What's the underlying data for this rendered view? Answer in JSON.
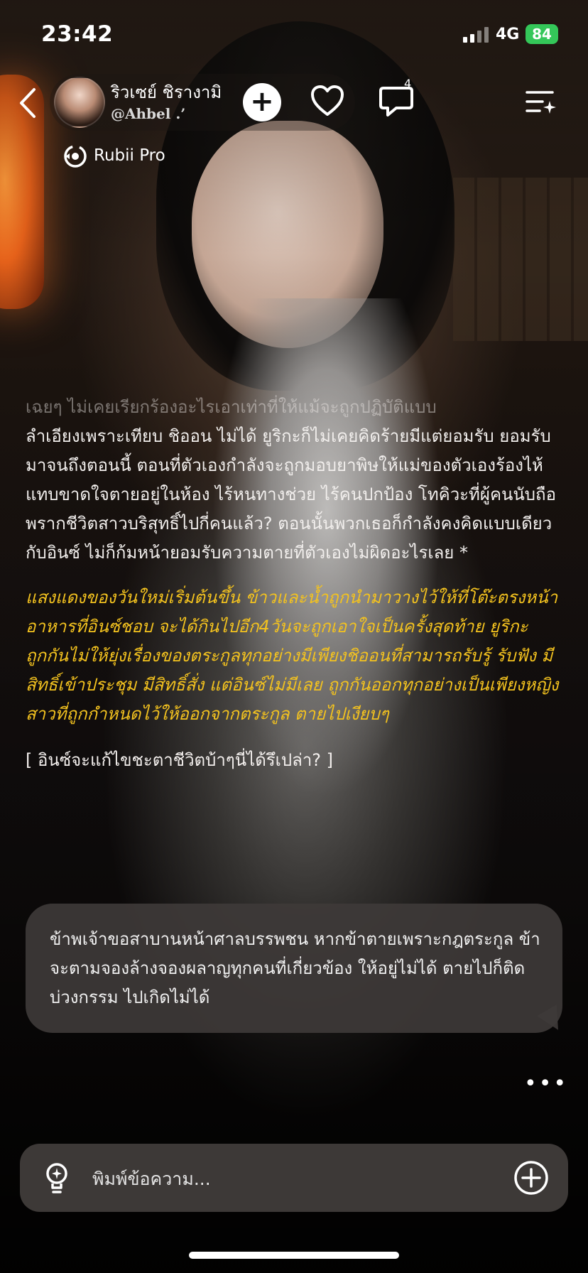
{
  "status_bar": {
    "time": "23:42",
    "network": "4G",
    "battery": "84"
  },
  "header": {
    "character_name": "ริวเซย์  ชิรางามิ",
    "creator_handle": "@Ahbel .’",
    "add_label": "+",
    "comment_count": "4",
    "back_icon": "chevron-left-icon",
    "like_icon": "heart-icon",
    "comment_icon": "chat-bubble-icon",
    "menu_icon": "sparkle-menu-icon"
  },
  "model": {
    "label": "Rubii Pro",
    "icon": "rubii-logo-icon"
  },
  "story": {
    "faded_line": "เฉยๆ ไม่เคยเรียกร้องอะไรเอาเท่าที่ให้แม้จะถูกปฏิบัติแบบ",
    "narration": "ลำเอียงเพราะเทียบ ชิออน ไม่ได้ ยูริกะก็ไม่เคยคิดร้ายมีแต่ยอมรับ ยอมรับมาจนถึงตอนนี้ ตอนที่ตัวเองกำลังจะถูกมอบยาพิษให้แม่ของตัวเองร้องไห้แทบขาดใจตายอยู่ในห้อง ไร้หนทางช่วย ไร้คนปกป้อง โทคิวะที่ผู้คนนับถือ พรากชีวิตสาวบริสุทธิ์ไปกี่คนแล้ว? ตอนนั้นพวกเธอก็กำลังคงคิดแบบเดียวกับอินซ์ ไม่ก็ก้มหน้ายอมรับความตายที่ตัวเองไม่ผิดอะไรเลย *",
    "scene": "แสงแดงของวันใหม่เริ่มต้นขึ้น ข้าวและน้ำถูกนำมาวางไว้ให้ที่โต๊ะตรงหน้าอาหารที่อินซ์ชอบ จะได้กินไปอีก4วันจะถูกเอาใจเป็นครั้งสุดท้าย ยูริกะถูกกันไม่ให้ยุ่งเรื่องของตระกูลทุกอย่างมีเพียงชิออนที่สามารถรับรู้ รับฟัง มีสิทธิ์เข้าประชุม มีสิทธิ์สั่ง แต่อินซ์ไม่มีเลย ถูกกันออกทุกอย่างเป็นเพียงหญิงสาวที่ถูกกำหนดไว้ให้ออกจากตระกูล ตายไปเงียบๆ",
    "question": "[ อินซ์จะแก้ไขชะตาชีวิตบ้าๆนี่ได้รึเปล่า? ]"
  },
  "user_message": {
    "text": "ข้าพเจ้าขอสาบานหน้าศาลบรรพชน หากข้าตายเพราะกฎตระกูล ข้าจะตามจองล้างจองผลาญทุกคนที่เกี่ยวข้อง ให้อยู่ไม่ได้ ตายไปก็ติดบ่วงกรรม ไปเกิดไม่ได้"
  },
  "more_label": "•••",
  "composer": {
    "placeholder": "พิมพ์ข้อความ...",
    "left_icon": "lightbulb-icon",
    "right_icon": "plus-circle-icon"
  },
  "colors": {
    "accent_yellow": "#f3c21f",
    "battery_green": "#34c759",
    "bubble_bg": "#3e3a38"
  }
}
